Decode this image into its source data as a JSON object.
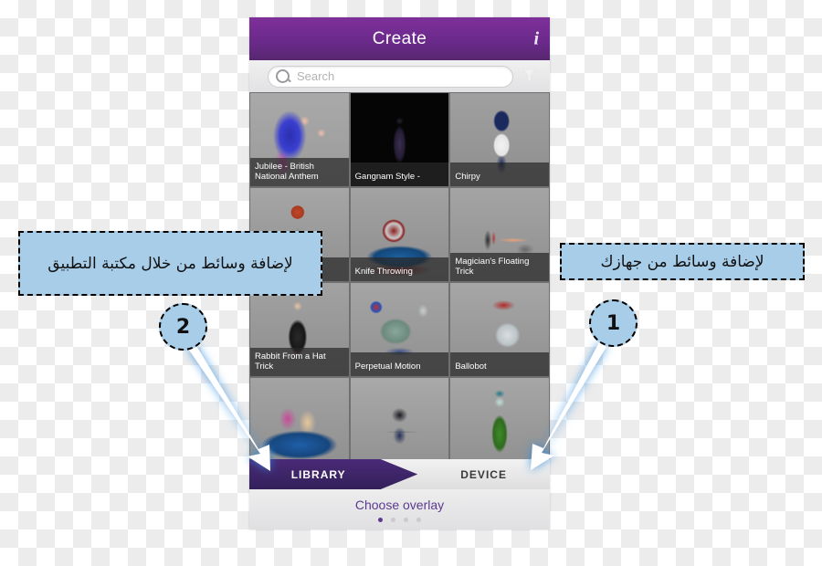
{
  "app": {
    "header": {
      "title": "Create",
      "info_icon": "info-italic-icon"
    },
    "search": {
      "placeholder": "Search",
      "value": "",
      "search_icon": "search-icon",
      "filter_icon": "filter-funnel-icon"
    },
    "grid": {
      "items": [
        {
          "label": "Jubilee - British National Anthem",
          "art": "art-jubilee"
        },
        {
          "label": "Gangnam Style -",
          "art": "art-gangnam"
        },
        {
          "label": "Chirpy",
          "art": "art-chirpy"
        },
        {
          "label": "",
          "art": "art-juggle"
        },
        {
          "label": "Knife Throwing",
          "art": "art-knife"
        },
        {
          "label": "Magician's Floating Trick",
          "art": "art-magician"
        },
        {
          "label": "Rabbit From a Hat Trick",
          "art": "art-rabbit"
        },
        {
          "label": "Perpetual Motion",
          "art": "art-perpetual"
        },
        {
          "label": "Ballobot",
          "art": "art-ballobot"
        },
        {
          "label": "",
          "art": "art-boxing"
        },
        {
          "label": "",
          "art": "art-ninja"
        },
        {
          "label": "",
          "art": "art-greengirl"
        }
      ]
    },
    "tabs": {
      "library_label": "LIBRARY",
      "device_label": "DEVICE",
      "active": "LIBRARY"
    },
    "footer": {
      "overlay_label": "Choose overlay",
      "dots_total": 4,
      "dots_active_index": 0
    }
  },
  "annotations": {
    "callout_left": {
      "text": "لإضافة وسائط من خلال مكتبة التطبيق",
      "badge": "2"
    },
    "callout_right": {
      "text": "لإضافة وسائط من جهازك",
      "badge": "1"
    }
  },
  "colors": {
    "header_purple": "#6b2a8c",
    "tab_active_purple": "#33205a",
    "callout_blue": "#a8cde8",
    "overlay_text_purple": "#5b3a8e",
    "checker_light": "#ffffff",
    "checker_dark": "#ececec"
  }
}
